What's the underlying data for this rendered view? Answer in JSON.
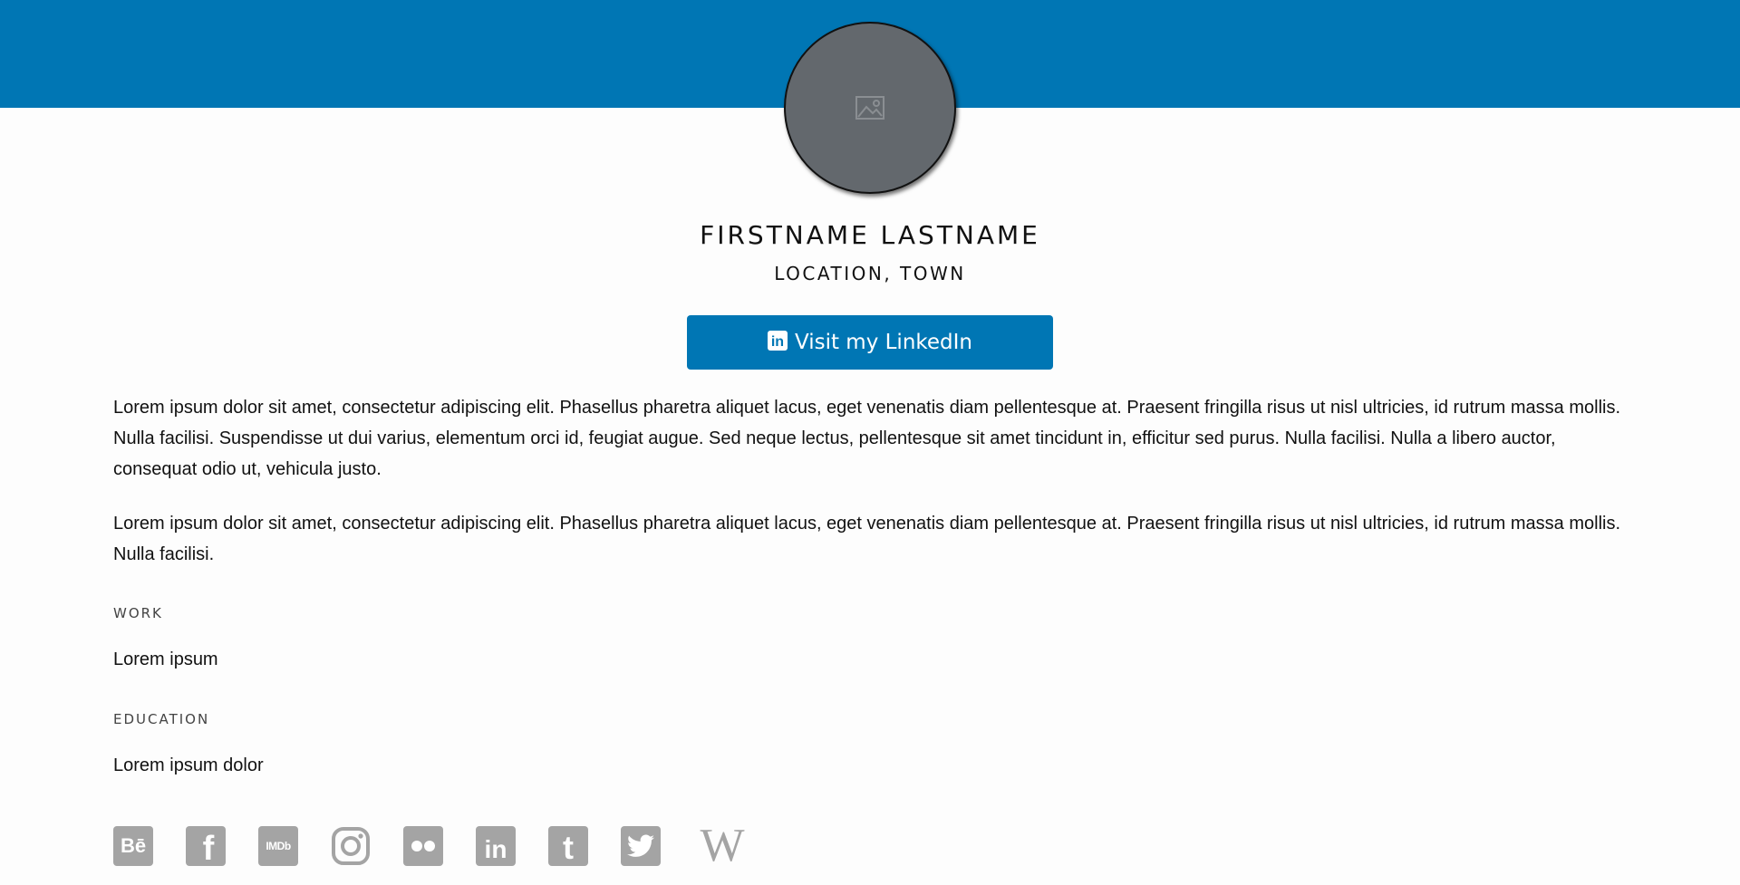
{
  "profile": {
    "name": "FIRSTNAME LASTNAME",
    "location": "LOCATION, TOWN",
    "avatar_icon": "image-placeholder-icon"
  },
  "linkedin_button": {
    "icon": "linkedin-icon",
    "icon_text": "in",
    "label": "Visit my LinkedIn"
  },
  "bio": [
    "Lorem ipsum dolor sit amet, consectetur adipiscing elit. Phasellus pharetra aliquet lacus, eget venenatis diam pellentesque at. Praesent fringilla risus ut nisl ultricies, id rutrum massa mollis. Nulla facilisi. Suspendisse ut dui varius, elementum orci id, feugiat augue. Sed neque lectus, pellentesque sit amet tincidunt in, efficitur sed purus. Nulla facilisi. Nulla a libero auctor, consequat odio ut, vehicula justo.",
    "Lorem ipsum dolor sit amet, consectetur adipiscing elit. Phasellus pharetra aliquet lacus, eget venenatis diam pellentesque at. Praesent fringilla risus ut nisl ultricies, id rutrum massa mollis. Nulla facilisi."
  ],
  "work": {
    "label": "WORK",
    "value": "Lorem ipsum"
  },
  "education": {
    "label": "EDUCATION",
    "value": "Lorem ipsum dolor"
  },
  "social_links": [
    {
      "name": "behance-icon",
      "text": "Bē"
    },
    {
      "name": "facebook-icon",
      "text": "f"
    },
    {
      "name": "imdb-icon",
      "text": "IMDb"
    },
    {
      "name": "instagram-icon",
      "text": ""
    },
    {
      "name": "flickr-icon",
      "text": ""
    },
    {
      "name": "linkedin-icon",
      "text": "in"
    },
    {
      "name": "tumblr-icon",
      "text": "t"
    },
    {
      "name": "twitter-icon",
      "text": ""
    },
    {
      "name": "wikipedia-icon",
      "text": "W"
    }
  ],
  "colors": {
    "brand_blue": "#0076b4",
    "avatar_gray": "#63686d",
    "icon_gray": "#a4a4a4"
  }
}
